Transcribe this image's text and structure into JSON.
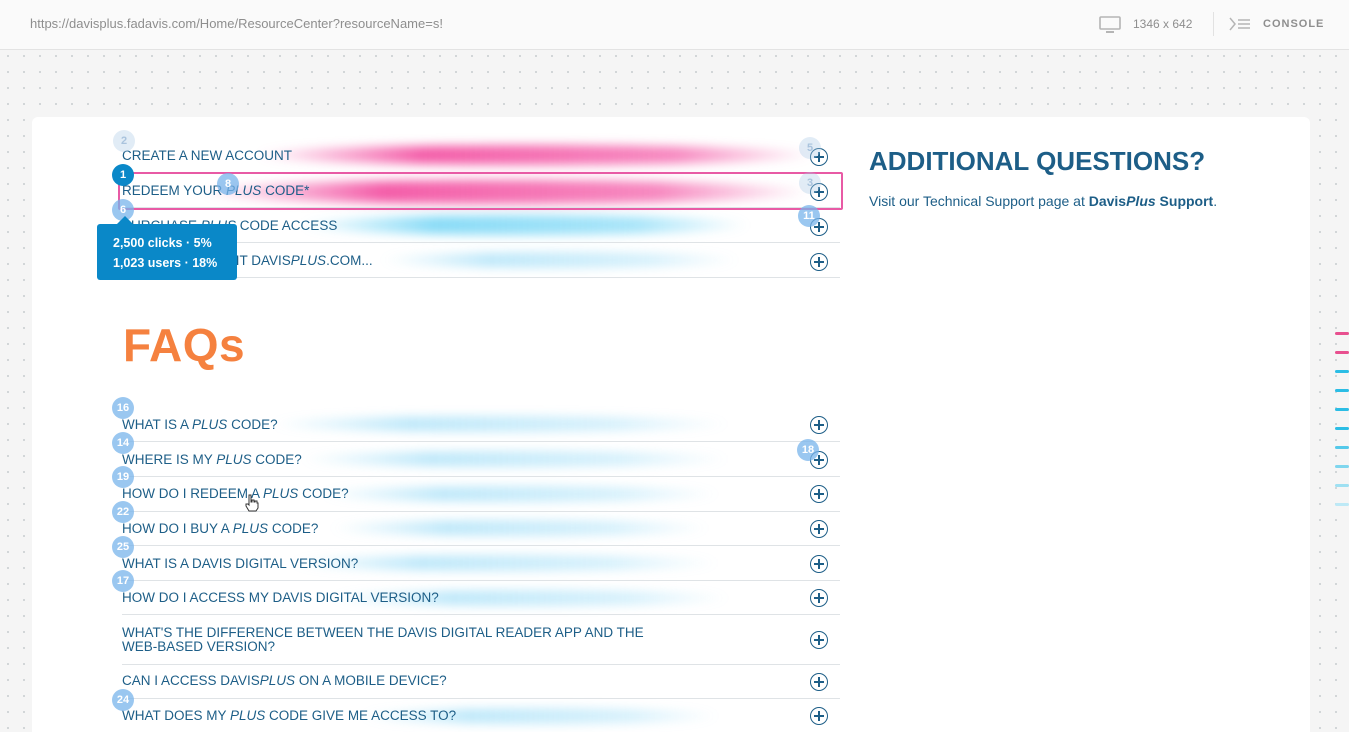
{
  "browser": {
    "url": "https://davisplus.fadavis.com/Home/ResourceCenter?resourceName=s!",
    "viewport_size": "1346 x 642",
    "console_label": "CONSOLE",
    "icons": [
      "monitor-icon",
      "console-icon"
    ]
  },
  "top_menu": [
    {
      "label": "CREATE A NEW ACCOUNT",
      "marker_left": "2",
      "marker_right": "5"
    },
    {
      "pre": "REDEEM YOUR ",
      "em": "PLUS",
      "post": " CODE*",
      "marker_left": "1",
      "marker_mid": "8",
      "marker_right": "3"
    },
    {
      "pre": "PURCHASE ",
      "em": "PLUS",
      "post": " CODE ACCESS",
      "marker_left": "6",
      "marker_right": "11"
    },
    {
      "pre": "BEFORE YOU VISIT DAVIS",
      "em": "PLUS",
      "post": ".COM..."
    }
  ],
  "tooltip": {
    "line1": "2,500 clicks · 5%",
    "line2": "1,023 users · 18%"
  },
  "faq": {
    "title": "FAQs",
    "items": [
      {
        "pre": "WHAT IS A ",
        "em": "PLUS",
        "post": " CODE?",
        "marker": "16"
      },
      {
        "pre": "WHERE IS MY ",
        "em": "PLUS",
        "post": " CODE?",
        "marker": "14",
        "marker_right": "18"
      },
      {
        "pre": "HOW DO I REDEEM A ",
        "em": "PLUS",
        "post": " CODE?",
        "marker": "19"
      },
      {
        "pre": "HOW DO I BUY A ",
        "em": "PLUS",
        "post": " CODE?",
        "marker": "22"
      },
      {
        "pre": "WHAT IS A DAVIS DIGITAL VERSION?",
        "em": "",
        "post": "",
        "marker": "25"
      },
      {
        "pre": "HOW DO I ACCESS MY DAVIS DIGITAL VERSION?",
        "em": "",
        "post": "",
        "marker": "17"
      },
      {
        "pre": "WHAT'S THE DIFFERENCE BETWEEN THE DAVIS DIGITAL READER APP AND THE WEB-BASED VERSION?",
        "em": "",
        "post": ""
      },
      {
        "pre": "CAN I ACCESS DAVIS",
        "em": "PLUS",
        "post": " ON A MOBILE DEVICE?"
      },
      {
        "pre": "WHAT DOES MY ",
        "em": "PLUS",
        "post": " CODE GIVE ME ACCESS TO?",
        "marker": "24"
      }
    ]
  },
  "sidebar": {
    "title": "ADDITIONAL QUESTIONS?",
    "text_pre": "Visit our Technical Support page at ",
    "link_pre": "Davis",
    "link_em": "Plus",
    "link_post": " Support",
    "text_post": "."
  },
  "colors": {
    "brand_blue": "#1d5e87",
    "faq_orange": "#f5813f",
    "marker_active": "#0a88c8",
    "heat_pink": "#f0288c",
    "heat_cyan": "#28bef0"
  }
}
